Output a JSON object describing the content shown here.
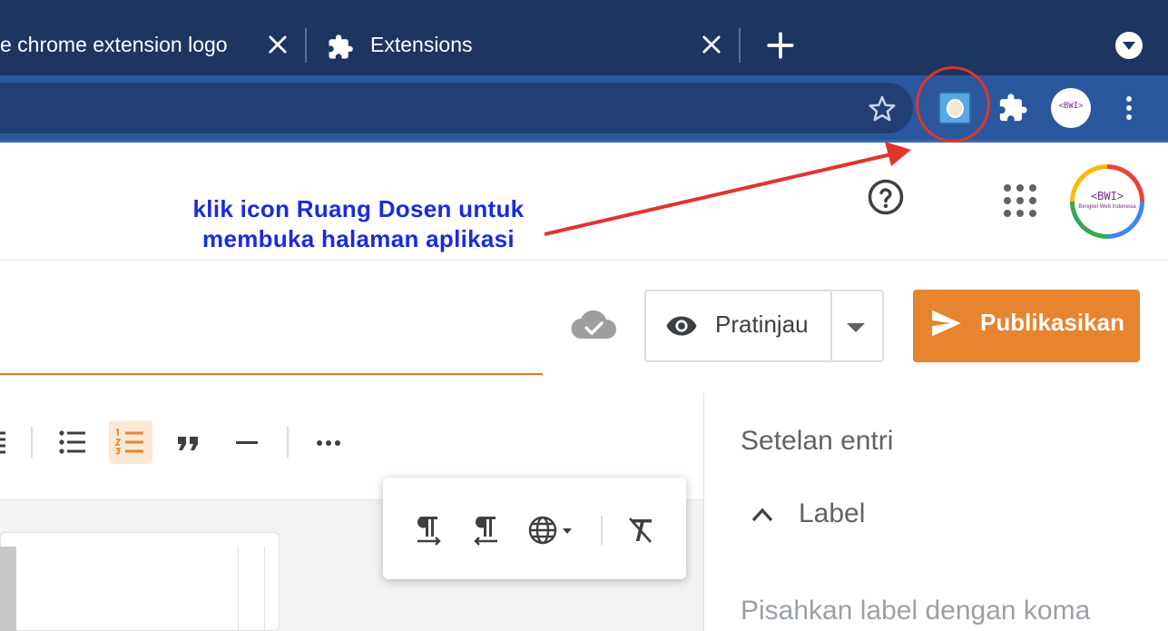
{
  "browser": {
    "tabs": [
      {
        "label": "e chrome extension logo"
      },
      {
        "label": "Extensions"
      }
    ],
    "extensions": {
      "ruang_dosen_name": "Ruang Dosen",
      "avatar_text": "<BWI>"
    }
  },
  "annotation": {
    "line1": "klik icon Ruang Dosen untuk",
    "line2": "membuka halaman aplikasi",
    "color": "#1a2bdc",
    "arrow_color": "#e0352b"
  },
  "header": {
    "account_logo_text": "<BWI>",
    "account_logo_subtext": "Bengkel Web Indonesia"
  },
  "editor": {
    "preview_label": "Pratinjau",
    "publish_label": "Publikasikan",
    "accent_color": "#e8832e"
  },
  "side_panel": {
    "title": "Setelan entri",
    "label_section": "Label",
    "label_placeholder": "Pisahkan label dengan koma"
  }
}
